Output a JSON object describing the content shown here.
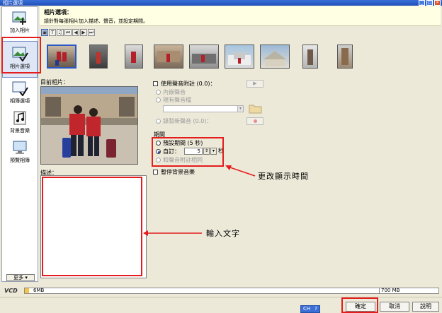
{
  "window": {
    "title": "相片選項"
  },
  "sidebar": {
    "items": [
      {
        "label": "加入相片"
      },
      {
        "label": "相片選項"
      },
      {
        "label": "相簿選項"
      },
      {
        "label": "背景音樂"
      },
      {
        "label": "預覽相簿"
      }
    ],
    "more_label": "更多"
  },
  "header": {
    "title": "相片選項：",
    "subtitle": "請針對每張相片加入描述、聲音，並設定期間。"
  },
  "preview": {
    "label": "目前相片："
  },
  "description": {
    "label": "描述："
  },
  "sound": {
    "use_label": "使用聲音附註 (0.0)：",
    "builtin_label": "內嵌聲音",
    "existing_label": "現有聲音檔",
    "record_label": "錄製新聲音 (0.0)："
  },
  "duration": {
    "section_label": "期間",
    "default_label": "預設期間 (5 秒)",
    "custom_label": "自訂：",
    "custom_value": "5",
    "unit_label": "秒",
    "sound_match_label": "和聲音附註相同"
  },
  "pause_music_label": "暫停背景音樂",
  "annotations": {
    "duration_note": "更改顯示時間",
    "text_note": "輸入文字"
  },
  "capacity": {
    "label": "VCD",
    "used": "6MB",
    "max": "700 MB",
    "fill_fraction": 0.01
  },
  "buttons": {
    "ok": "確定",
    "cancel": "取消",
    "help": "說明"
  },
  "ime": {
    "lang": "CH"
  },
  "colors": {
    "annotation_red": "#e41d1d",
    "header_bg": "#ffffe3",
    "capacity_fill": "#f6c445"
  }
}
